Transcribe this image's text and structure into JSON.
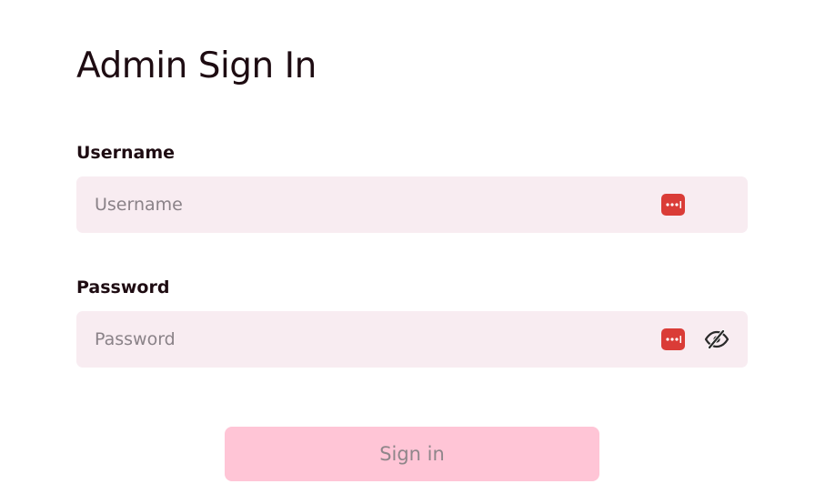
{
  "page": {
    "title": "Admin Sign In"
  },
  "form": {
    "username": {
      "label": "Username",
      "placeholder": "Username",
      "value": ""
    },
    "password": {
      "label": "Password",
      "placeholder": "Password",
      "value": ""
    },
    "submit_label": "Sign in"
  },
  "icons": {
    "password_manager": "password-manager-icon",
    "visibility_toggle": "eye-slash-icon"
  },
  "colors": {
    "input_bg": "#f8ecf1",
    "button_bg": "#ffc5d6",
    "password_manager": "#da3c37",
    "text": "#1e0c12",
    "placeholder": "#8a8288"
  }
}
